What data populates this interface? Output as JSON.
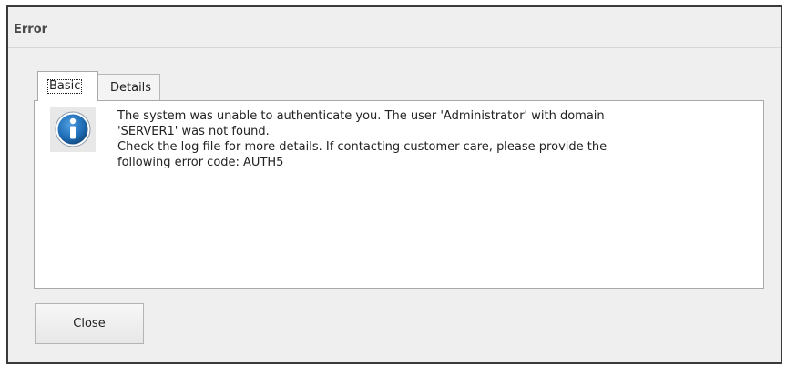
{
  "window": {
    "title": "Error"
  },
  "tabs": [
    {
      "label": "Basic",
      "active": true
    },
    {
      "label": "Details",
      "active": false
    }
  ],
  "message": {
    "icon": "info-icon",
    "lines": [
      "The system was unable to authenticate you. The user 'Administrator' with domain",
      "'SERVER1' was not found.",
      "Check the log file for more details. If contacting customer care, please provide the",
      "following error code: AUTH5"
    ]
  },
  "buttons": {
    "close_label": "Close"
  },
  "colors": {
    "dialog_background": "#efefef",
    "icon_blue": "#1e6cb5"
  }
}
